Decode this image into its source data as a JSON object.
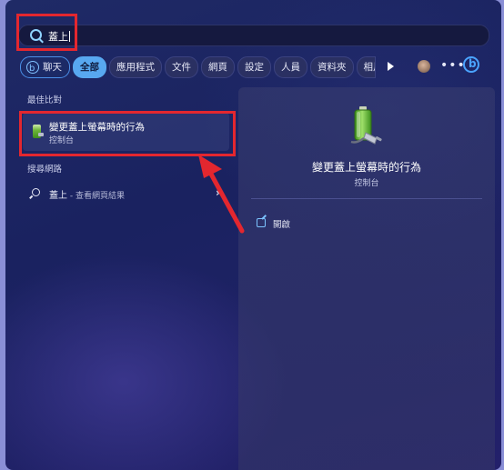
{
  "search": {
    "query": "蓋上"
  },
  "filters": [
    {
      "label": "聊天",
      "kind": "bing"
    },
    {
      "label": "全部",
      "kind": "active"
    },
    {
      "label": "應用程式",
      "kind": "normal"
    },
    {
      "label": "文件",
      "kind": "normal"
    },
    {
      "label": "網頁",
      "kind": "normal"
    },
    {
      "label": "設定",
      "kind": "normal"
    },
    {
      "label": "人員",
      "kind": "normal"
    },
    {
      "label": "資料夾",
      "kind": "normal"
    },
    {
      "label": "相片",
      "kind": "normal"
    }
  ],
  "left": {
    "best_match_label": "最佳比對",
    "best_match": {
      "title": "變更蓋上螢幕時的行為",
      "subtitle": "控制台"
    },
    "web_label": "搜尋網路",
    "web_result": {
      "query": "蓋上",
      "suffix": " - 查看網頁結果"
    }
  },
  "right": {
    "title": "變更蓋上螢幕時的行為",
    "subtitle": "控制台",
    "actions": [
      {
        "label": "開啟"
      }
    ]
  },
  "colors": {
    "highlight": "#e3272f",
    "accent": "#58a8f0",
    "bing": "#4aa3ff"
  },
  "icons": [
    "search-icon",
    "bing-icon",
    "play-icon",
    "avatar",
    "more-icon",
    "bing-logo-icon",
    "battery-plug-icon",
    "chevron-right-icon",
    "open-external-icon"
  ]
}
